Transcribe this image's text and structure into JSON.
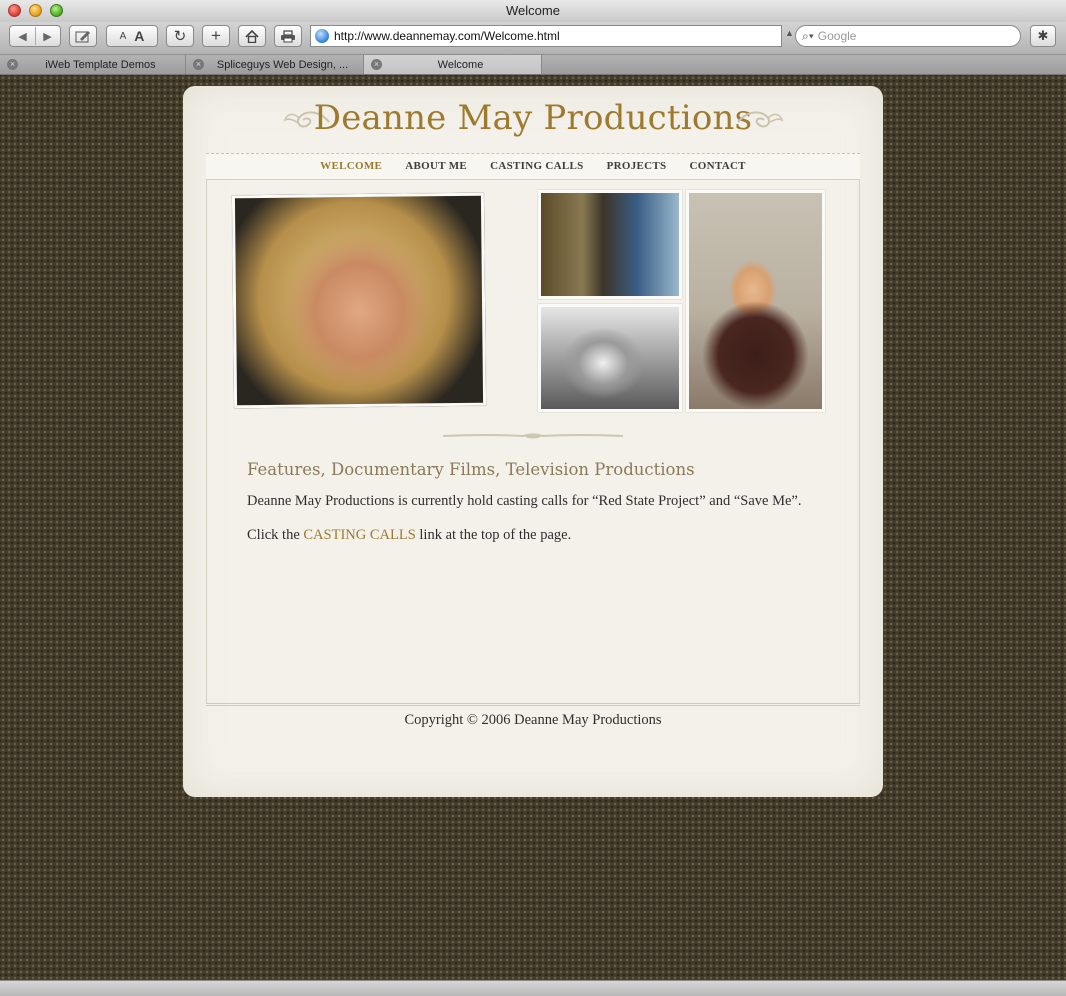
{
  "window": {
    "title": "Welcome"
  },
  "toolbar": {
    "url": "http://www.deannemay.com/Welcome.html",
    "search_placeholder": "Google",
    "text_small": "A",
    "text_big": "A"
  },
  "tabs": [
    {
      "label": "iWeb Template Demos"
    },
    {
      "label": "Spliceguys Web Design, ..."
    },
    {
      "label": "Welcome"
    }
  ],
  "site": {
    "title": "Deanne May Productions",
    "nav": [
      "WELCOME",
      "ABOUT ME",
      "CASTING CALLS",
      "PROJECTS",
      "CONTACT"
    ],
    "nav_current": "WELCOME",
    "heading": "Features, Documentary Films, Television Productions",
    "line1": "Deanne May Productions is currently hold casting calls for “Red State Project” and “Save Me”.",
    "line2_prefix": "Click the ",
    "line2_link": "CASTING CALLS",
    "line2_suffix": " link at the top of the page.",
    "copyright": "Copyright © 2006 Deanne May Productions"
  },
  "colors": {
    "accent_gold": "#9e7a2f",
    "page_background": "#433b2b",
    "card_background": "#f3f1ea"
  }
}
